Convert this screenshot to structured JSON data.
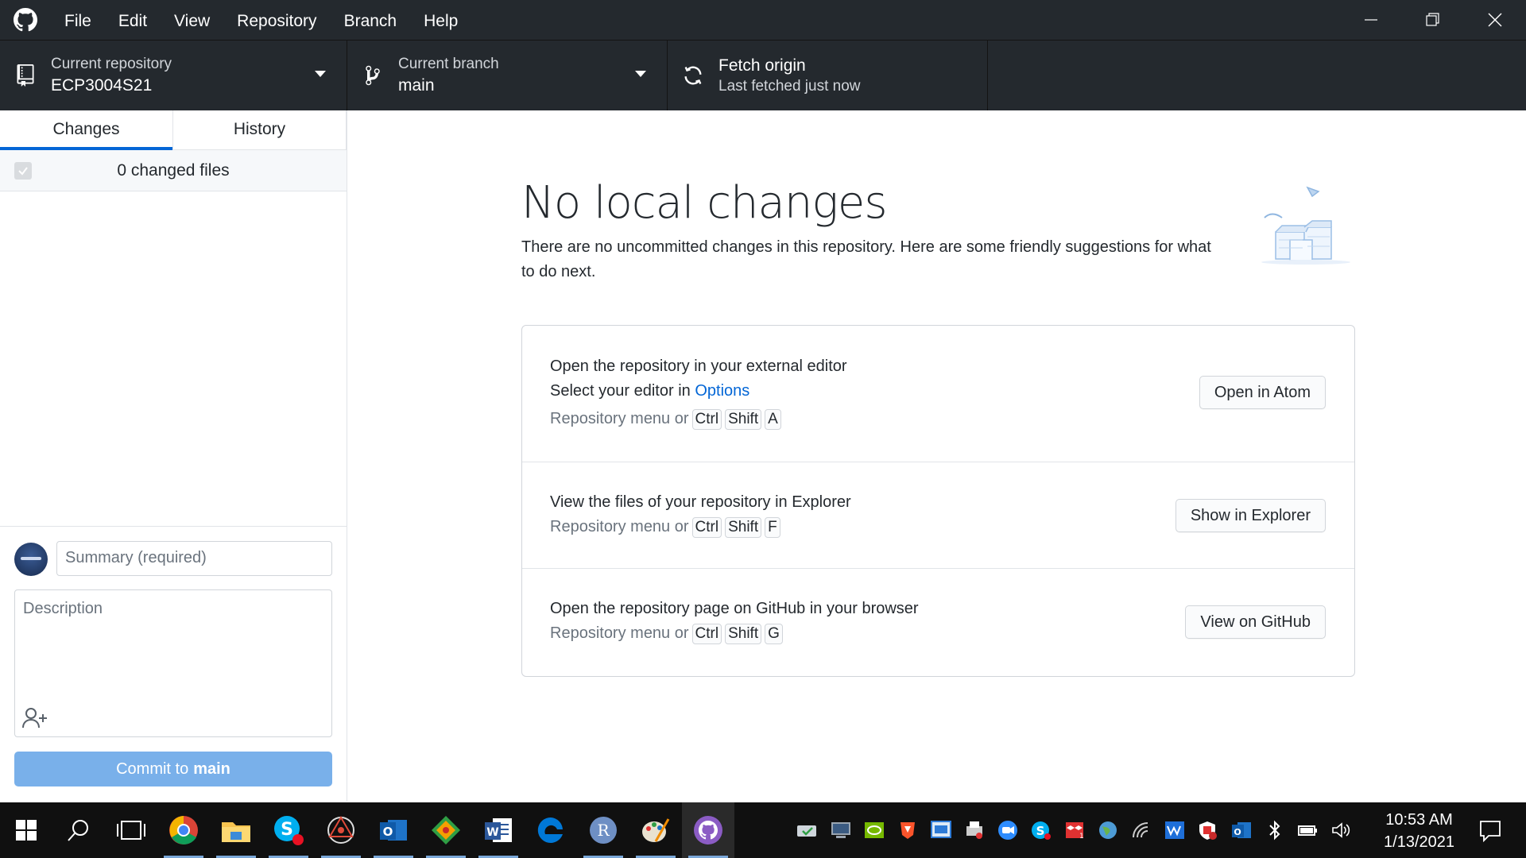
{
  "menu": [
    "File",
    "Edit",
    "View",
    "Repository",
    "Branch",
    "Help"
  ],
  "toolbar": {
    "repo_label": "Current repository",
    "repo_value": "ECP3004S21",
    "branch_label": "Current branch",
    "branch_value": "main",
    "fetch_title": "Fetch origin",
    "fetch_sub": "Last fetched just now"
  },
  "sidebar": {
    "tabs": [
      "Changes",
      "History"
    ],
    "changed_files": "0 changed files",
    "summary_placeholder": "Summary (required)",
    "description_placeholder": "Description",
    "commit_prefix": "Commit to",
    "commit_branch": "main"
  },
  "main": {
    "title": "No local changes",
    "description": "There are no uncommitted changes in this repository. Here are some friendly suggestions for what to do next.",
    "cards": [
      {
        "title": "Open the repository in your external editor",
        "sub_prefix": "Select your editor in",
        "sub_link": "Options",
        "menu_hint": "Repository menu or",
        "keys": [
          "Ctrl",
          "Shift",
          "A"
        ],
        "button": "Open in Atom"
      },
      {
        "title": "View the files of your repository in Explorer",
        "menu_hint": "Repository menu or",
        "keys": [
          "Ctrl",
          "Shift",
          "F"
        ],
        "button": "Show in Explorer"
      },
      {
        "title": "Open the repository page on GitHub in your browser",
        "menu_hint": "Repository menu or",
        "keys": [
          "Ctrl",
          "Shift",
          "G"
        ],
        "button": "View on GitHub"
      }
    ]
  },
  "taskbar": {
    "time": "10:53 AM",
    "date": "1/13/2021"
  },
  "colors": {
    "toolbar_bg": "#24292e",
    "accent": "#0366d6",
    "commit_button": "#79b0ea"
  }
}
